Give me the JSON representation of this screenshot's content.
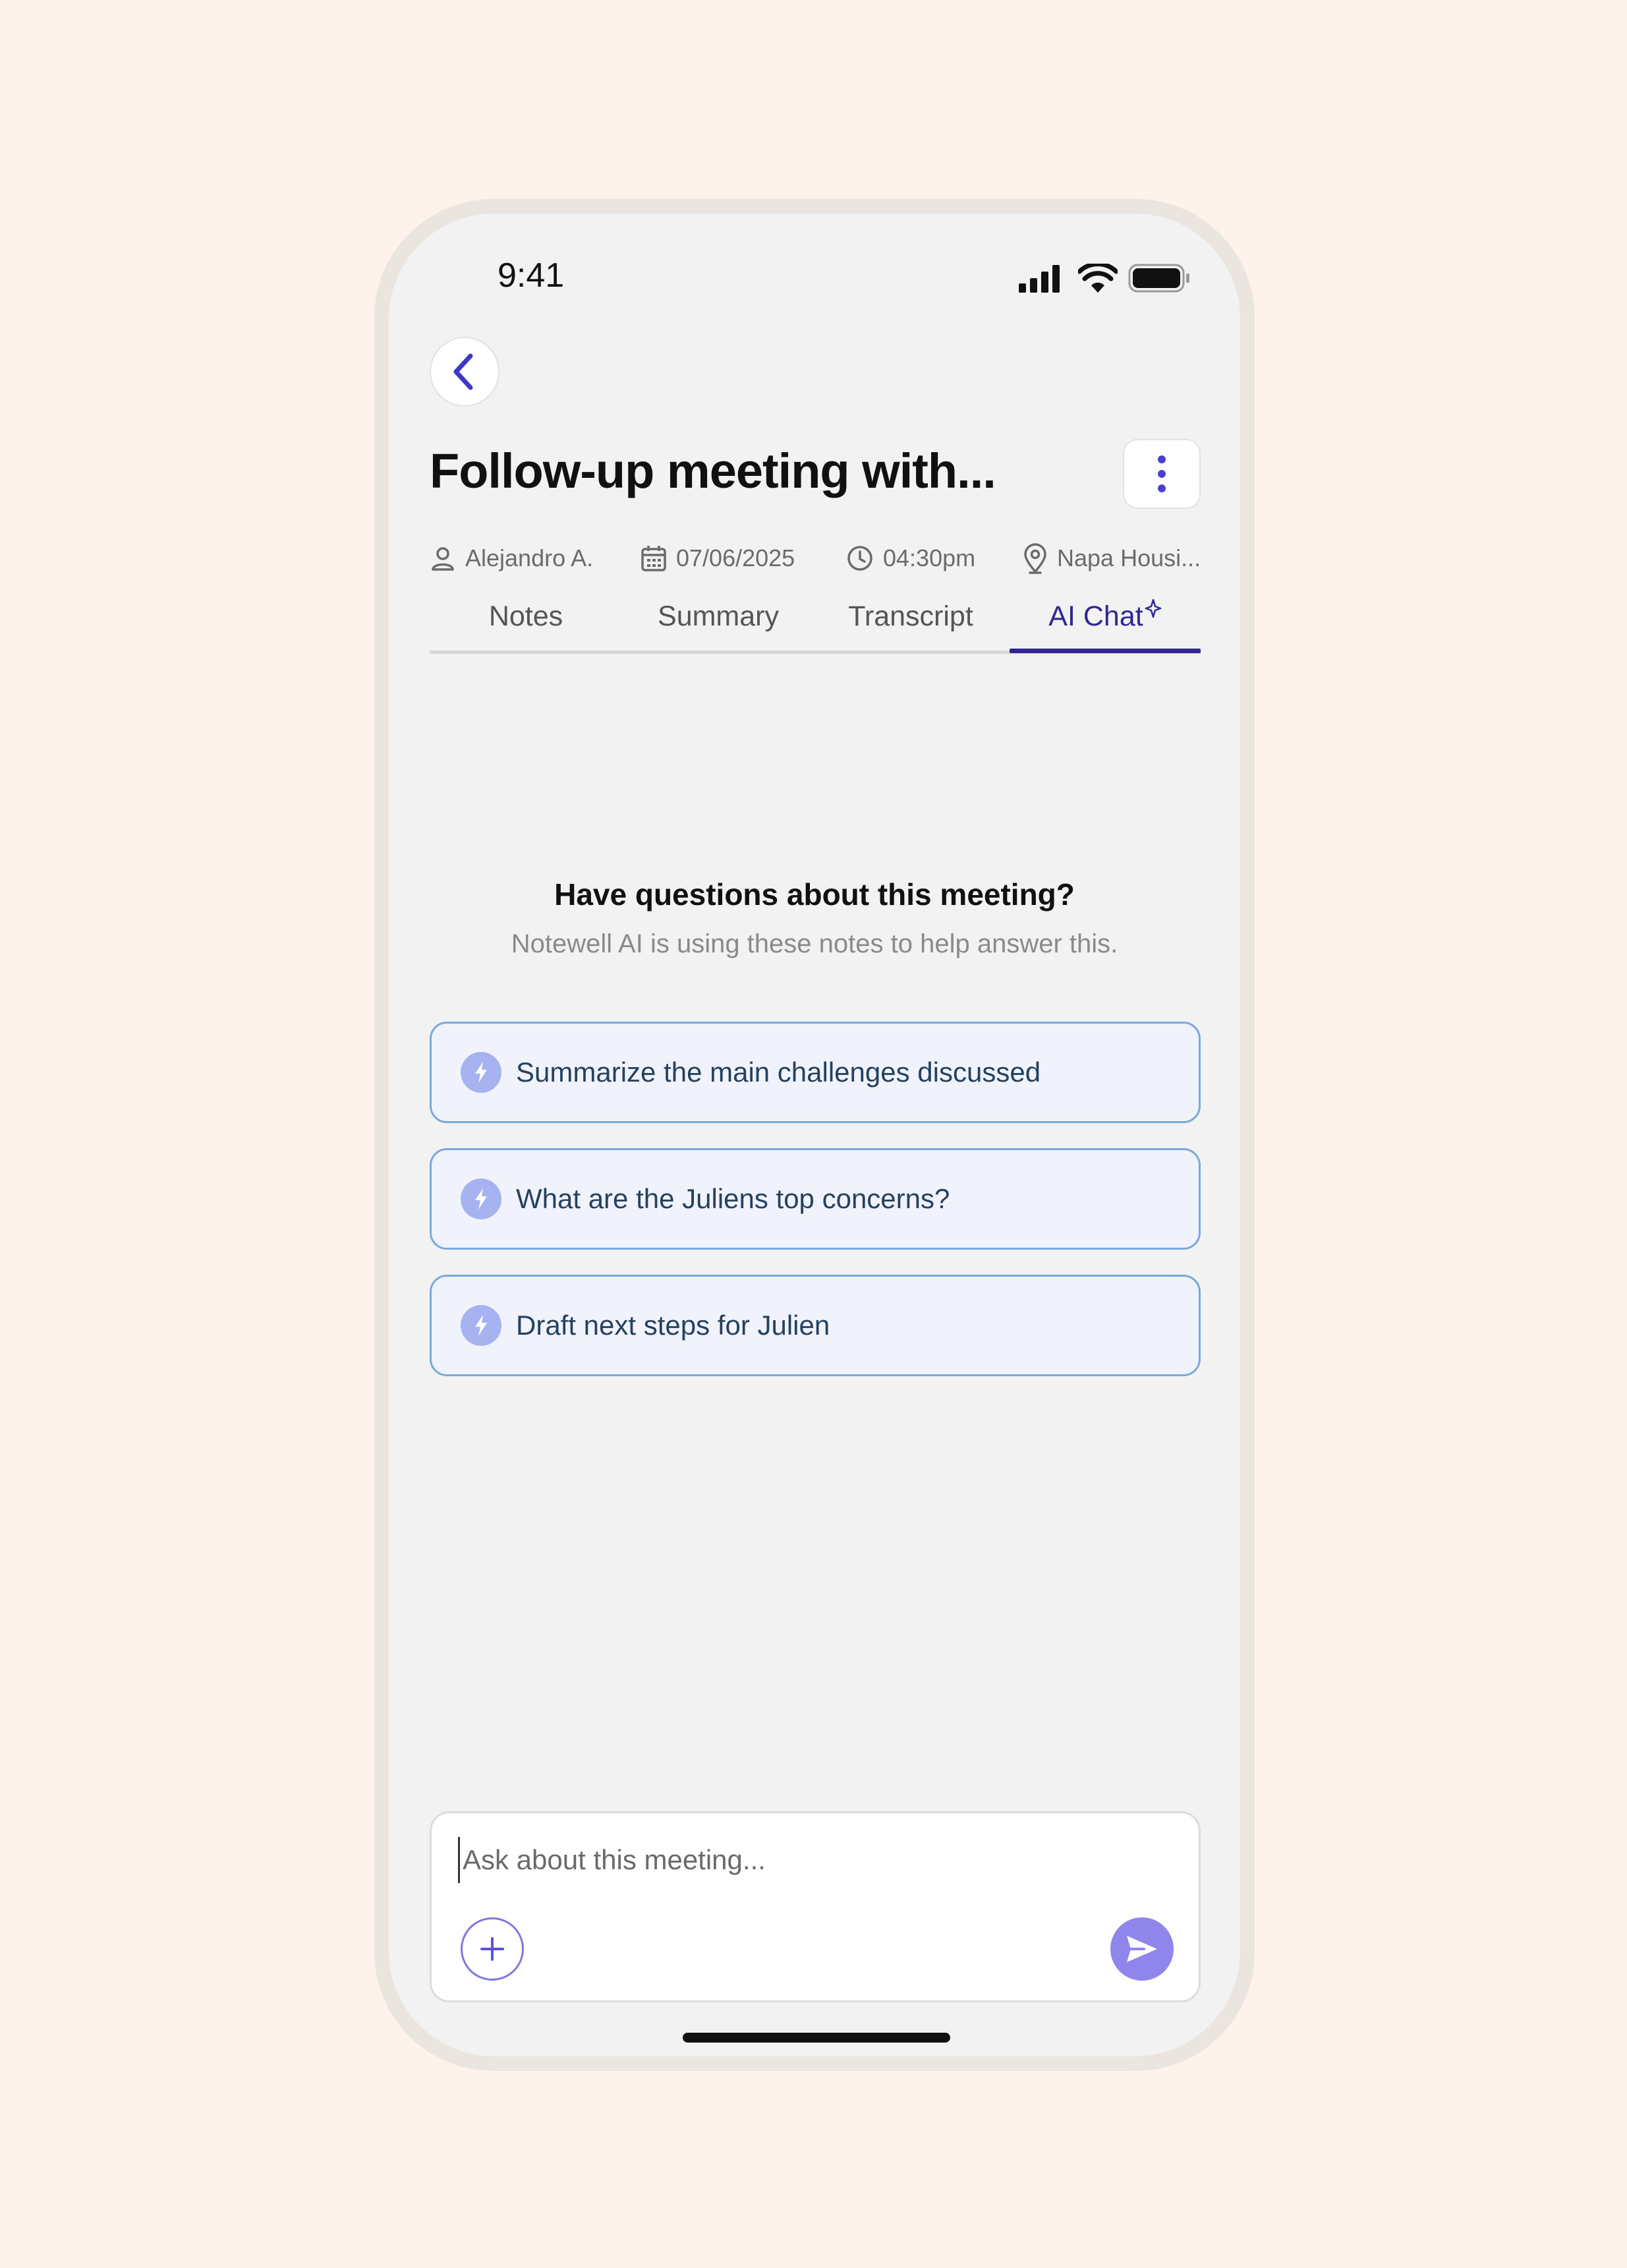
{
  "status_bar": {
    "time": "9:41",
    "icons": [
      "signal-icon",
      "wifi-icon",
      "battery-icon"
    ]
  },
  "header": {
    "title": "Follow-up meeting with...",
    "back_icon": "chevron-left-icon",
    "more_icon": "more-vertical-icon"
  },
  "meta": {
    "person": "Alejandro A.",
    "date": "07/06/2025",
    "time": "04:30pm",
    "location": "Napa Housi..."
  },
  "tabs": [
    {
      "label": "Notes",
      "active": false
    },
    {
      "label": "Summary",
      "active": false
    },
    {
      "label": "Transcript",
      "active": false
    },
    {
      "label": "AI Chat",
      "active": true,
      "badge_icon": "sparkle-icon"
    }
  ],
  "chat": {
    "heading": "Have questions about this meeting?",
    "subheading": "Notewell AI is using these notes to help answer this.",
    "suggestions": [
      {
        "label": "Summarize the main challenges discussed",
        "icon": "bolt-icon"
      },
      {
        "label": "What are the Juliens top concerns?",
        "icon": "bolt-icon"
      },
      {
        "label": "Draft next steps for Julien",
        "icon": "bolt-icon"
      }
    ]
  },
  "composer": {
    "placeholder": "Ask about this meeting...",
    "value": "",
    "add_icon": "plus-icon",
    "send_icon": "send-icon"
  },
  "colors": {
    "background": "#fdf3ea",
    "accent": "#2f2891",
    "suggestion_border": "#7aa9dc",
    "suggestion_bg": "#f0f3fc",
    "send_button": "#8f85ea"
  }
}
